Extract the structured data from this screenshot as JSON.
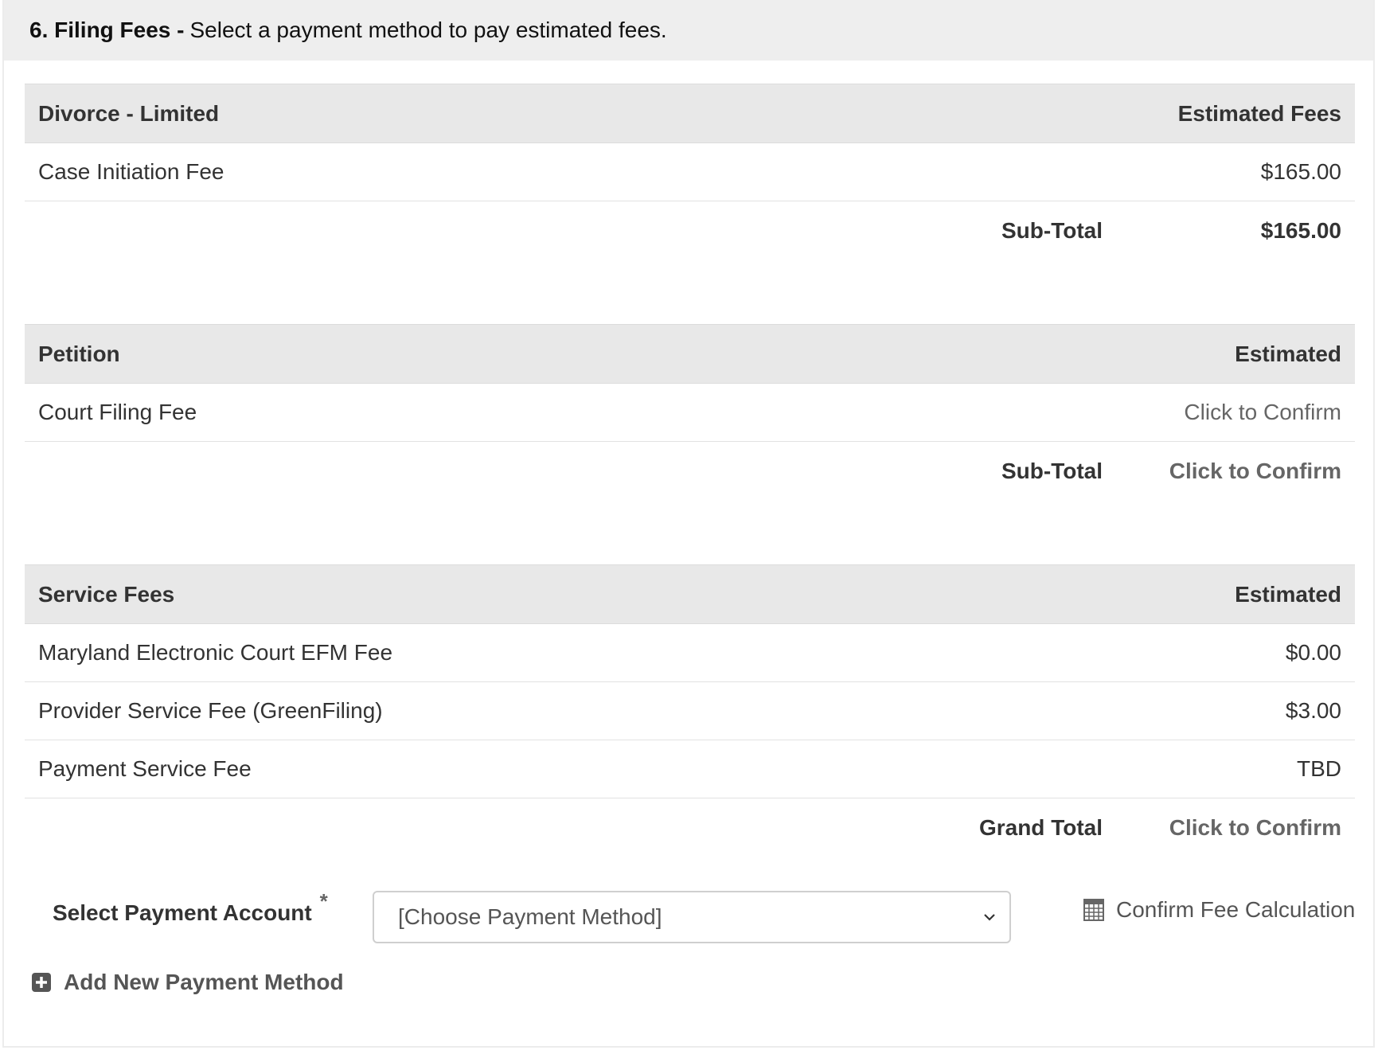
{
  "header": {
    "step": "6. Filing Fees -",
    "description": "Select a payment method to pay estimated fees."
  },
  "sections": [
    {
      "title": "Divorce - Limited",
      "column": "Estimated Fees",
      "rows": [
        {
          "name": "Case Initiation Fee",
          "amount": "$165.00"
        }
      ],
      "total_label": "Sub-Total",
      "total_value": "$165.00"
    },
    {
      "title": "Petition",
      "column": "Estimated",
      "rows": [
        {
          "name": "Court Filing Fee",
          "amount": "Click to Confirm"
        }
      ],
      "total_label": "Sub-Total",
      "total_value": "Click to Confirm"
    },
    {
      "title": "Service Fees",
      "column": "Estimated",
      "rows": [
        {
          "name": "Maryland Electronic Court EFM Fee",
          "amount": "$0.00"
        },
        {
          "name": "Provider Service Fee (GreenFiling)",
          "amount": "$3.00"
        },
        {
          "name": "Payment Service Fee",
          "amount": "TBD"
        }
      ],
      "total_label": "Grand Total",
      "total_value": "Click to Confirm"
    }
  ],
  "payment": {
    "label": "Select Payment Account",
    "required_mark": "*",
    "select_value": "[Choose Payment Method]",
    "confirm_label": "Confirm Fee Calculation",
    "add_label": "Add New Payment Method"
  },
  "icons": {
    "confirm": "calculator-icon",
    "add": "plus-square-icon",
    "select": "chevron-down-icon"
  }
}
